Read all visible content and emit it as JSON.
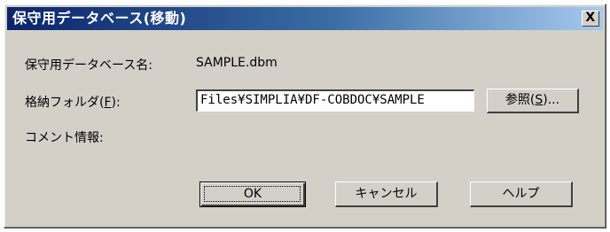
{
  "dialog": {
    "title": "保守用データベース(移動)",
    "close_label": "X"
  },
  "fields": {
    "db_name_label": "保守用データベース名:",
    "db_name_value": "SAMPLE.dbm",
    "folder_label_prefix": "格納フォルダ(",
    "folder_label_key": "F",
    "folder_label_suffix": "):",
    "folder_value": "Files¥SIMPLIA¥DF-COBDOC¥SAMPLE",
    "comment_label": "コメント情報:"
  },
  "buttons": {
    "browse_prefix": "参照(",
    "browse_key": "S",
    "browse_suffix": ")...",
    "ok": "OK",
    "cancel": "キャンセル",
    "help": "ヘルプ"
  }
}
